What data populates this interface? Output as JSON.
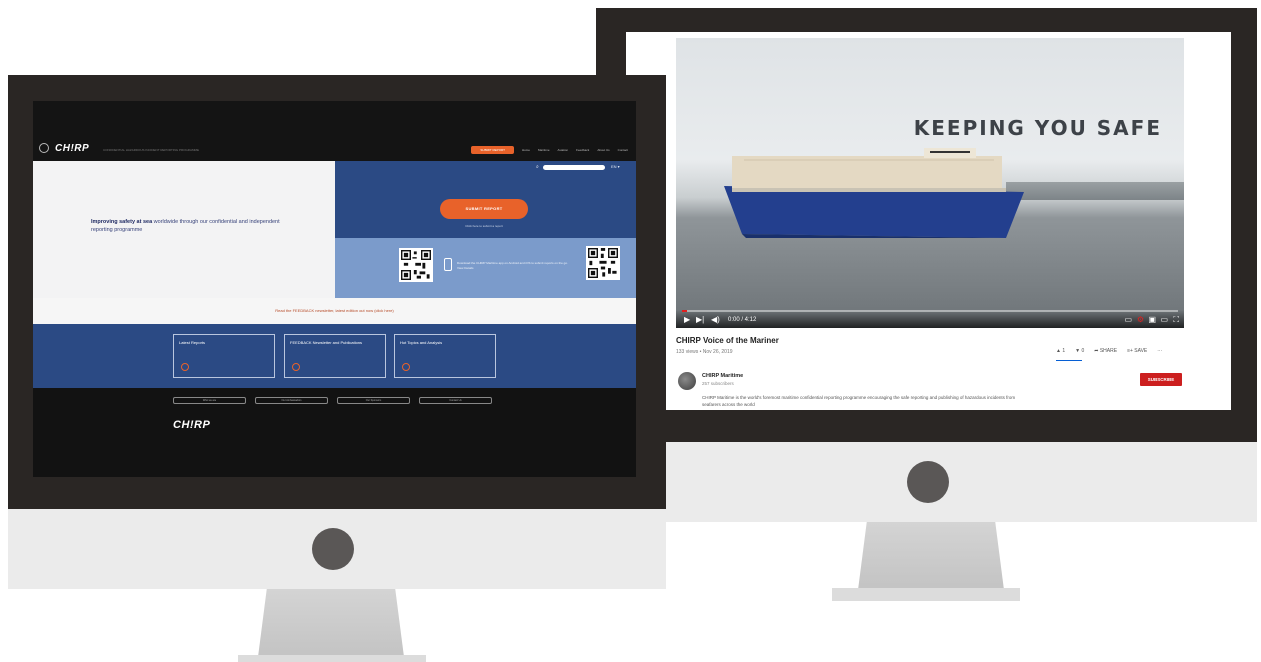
{
  "youtube": {
    "headline": "KEEPING YOU SAFE",
    "video_title": "CHIRP Voice of the Mariner",
    "meta": "133 views • Nov 26, 2019",
    "time": "0:00 / 4:12",
    "progress": 0.01,
    "actions": [
      "▲ 1",
      "▼ 0",
      "➦ SHARE",
      "≡+ SAVE",
      "···"
    ],
    "channel": "CHIRP Maritime",
    "subscribers": "257 subscribers",
    "subscribe_label": "SUBSCRIBE",
    "description": "CHIRP Maritime is the world's foremost maritime confidential reporting programme encouraging the safe reporting and publishing of hazardous incidents from seafarers across the world"
  },
  "chirp": {
    "logo": "CH!RP",
    "tagline": "CONFIDENTIAL HAZARDOUS INCIDENT REPORTING PROGRAMME",
    "nav_cta": "SUBMIT REPORT",
    "nav": [
      "Home",
      "Maritime",
      "Aviation",
      "Feedback",
      "About Us",
      "Contact"
    ],
    "lang": "EN ▾",
    "hero_bold": "Improving safety at sea",
    "hero_rest": " worldwide through our confidential and independent reporting programme",
    "submit_label": "SUBMIT REPORT",
    "submit_sub": "Click here to submit a report",
    "app_text": "Download the CHIRP Maritime app on Android and iOS to submit reports on the go. View Details",
    "notice": "Read the FEEDBACK newsletter, latest edition out now (click here)",
    "cards": [
      {
        "label": "Latest Reports"
      },
      {
        "label": "FEEDBACK Newsletter and Publications"
      },
      {
        "label": "Hot Topics and Analysis"
      }
    ],
    "footer_buttons": [
      "Who we are",
      "Our Ambassadors",
      "Our Sponsors",
      "Contact Us"
    ],
    "footer_logo": "CH!RP"
  },
  "colors": {
    "accent": "#e8622a",
    "navy": "#2b4a84",
    "youtube_red": "#cc1f1f"
  }
}
